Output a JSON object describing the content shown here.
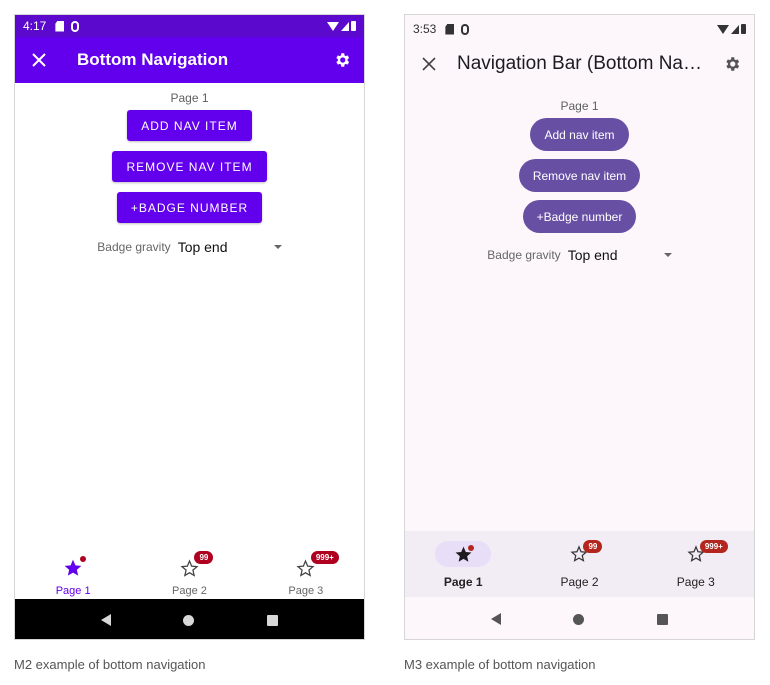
{
  "m2": {
    "status": {
      "time": "4:17"
    },
    "appbar": {
      "title": "Bottom Navigation"
    },
    "content": {
      "page_label": "Page 1",
      "buttons": [
        "Add nav item",
        "Remove nav item",
        "+Badge number"
      ],
      "gravity_label": "Badge gravity",
      "gravity_value": "Top end"
    },
    "nav": [
      {
        "label": "Page 1",
        "badge": ""
      },
      {
        "label": "Page 2",
        "badge": "99"
      },
      {
        "label": "Page 3",
        "badge": "999+"
      }
    ],
    "caption": "M2 example of bottom navigation",
    "colors": {
      "primary": "#6200ee",
      "status_bar": "#5b09cc",
      "badge": "#b00020"
    }
  },
  "m3": {
    "status": {
      "time": "3:53"
    },
    "appbar": {
      "title": "Navigation Bar (Bottom Navi..."
    },
    "content": {
      "page_label": "Page 1",
      "buttons": [
        "Add nav item",
        "Remove nav item",
        "+Badge number"
      ],
      "gravity_label": "Badge gravity",
      "gravity_value": "Top end"
    },
    "nav": [
      {
        "label": "Page 1",
        "badge": ""
      },
      {
        "label": "Page 2",
        "badge": "99"
      },
      {
        "label": "Page 3",
        "badge": "999+"
      }
    ],
    "caption": "M3 example of bottom navigation",
    "colors": {
      "primary": "#6750a4",
      "surface": "#fdf7fc",
      "nav_bg": "#f2ecf5",
      "indicator": "#e8def8",
      "badge": "#b3261e"
    }
  },
  "icons": {
    "close": "close-icon",
    "settings": "gear-icon",
    "nav_active": "star-filled-icon",
    "nav_inactive": "star-outline-icon",
    "back": "back-triangle-icon",
    "home": "home-circle-icon",
    "recents": "recents-square-icon"
  }
}
